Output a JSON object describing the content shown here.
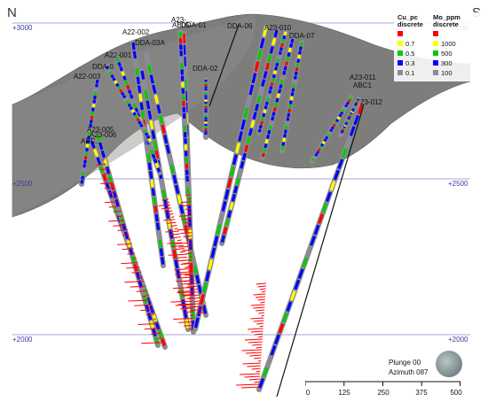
{
  "orientation": {
    "left": "N",
    "right": "S"
  },
  "elevations": {
    "top": "+3000",
    "middle": "+2500",
    "bottom": "+2000"
  },
  "hole_labels": [
    {
      "id": "a22-002",
      "text": "A22-002"
    },
    {
      "id": "dda-03a",
      "text": "DDA-03A"
    },
    {
      "id": "a22-001",
      "text": "A22-001"
    },
    {
      "id": "dda-0",
      "text": "DDA-0"
    },
    {
      "id": "a22-003",
      "text": "A22-003"
    },
    {
      "id": "a23-top",
      "text": "A23-..."
    },
    {
      "id": "ab05",
      "text": "AB05"
    },
    {
      "id": "dda-01",
      "text": "DDA-01"
    },
    {
      "id": "dda-06",
      "text": "DDA-06"
    },
    {
      "id": "a23-010",
      "text": "A23-010"
    },
    {
      "id": "dda-07",
      "text": "DDA-07"
    },
    {
      "id": "dda-02",
      "text": "DDA-02"
    },
    {
      "id": "a23-011",
      "text": "A23-011"
    },
    {
      "id": "abc1-right",
      "text": "ABC1"
    },
    {
      "id": "a23-012",
      "text": "23-012"
    },
    {
      "id": "a23-005",
      "text": "A23-005"
    },
    {
      "id": "a23-006",
      "text": "A23-006"
    },
    {
      "id": "abc-left",
      "text": "ABC..."
    }
  ],
  "legend": {
    "cu_title": "Cu_pc\ndiscrete",
    "mo_title": "Mo_ppm\ndiscrete",
    "cu_items": [
      {
        "label": "",
        "color": "#ff0000"
      },
      {
        "label": "0.7",
        "color": "#ffff00"
      },
      {
        "label": "0.5",
        "color": "#00cc00"
      },
      {
        "label": "0.3",
        "color": "#0000ff"
      },
      {
        "label": "0.1",
        "color": "#8a8aa0"
      }
    ],
    "mo_items": [
      {
        "label": "",
        "color": "#ff0000"
      },
      {
        "label": "1000",
        "color": "#ffff00"
      },
      {
        "label": "500",
        "color": "#00cc00"
      },
      {
        "label": "300",
        "color": "#0000ff"
      },
      {
        "label": "100",
        "color": "#8a8aa0"
      }
    ]
  },
  "view": {
    "plunge": "Plunge 00",
    "azimuth": "Azimuth 087"
  },
  "scale_bar": {
    "ticks": [
      "0",
      "125",
      "250",
      "375",
      "500"
    ]
  },
  "colors": {
    "surface": "#7d7d7b",
    "grid": "#9a9ad0",
    "trace": "#777777"
  }
}
